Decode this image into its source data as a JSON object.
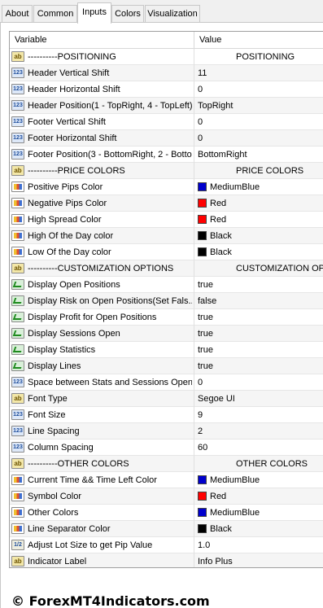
{
  "tabs": [
    {
      "label": "About",
      "active": false
    },
    {
      "label": "Common",
      "active": false
    },
    {
      "label": "Inputs",
      "active": true
    },
    {
      "label": "Colors",
      "active": false
    },
    {
      "label": "Visualization",
      "active": false
    }
  ],
  "grid": {
    "col_variable": "Variable",
    "col_value": "Value"
  },
  "rows": [
    {
      "icon": "ab",
      "name": "----------POSITIONING",
      "value": "POSITIONING",
      "section": true
    },
    {
      "icon": "num",
      "name": "Header Vertical Shift",
      "value": "11"
    },
    {
      "icon": "num",
      "name": "Header Horizontal Shift",
      "value": "0"
    },
    {
      "icon": "num",
      "name": "Header Position(1 - TopRight, 4 - TopLeft)",
      "value": "TopRight"
    },
    {
      "icon": "num",
      "name": "Footer Vertical Shift",
      "value": "0"
    },
    {
      "icon": "num",
      "name": "Footer Horizontal Shift",
      "value": "0"
    },
    {
      "icon": "num",
      "name": "Footer Position(3 - BottomRight, 2 - Botto...",
      "value": "BottomRight"
    },
    {
      "icon": "ab",
      "name": "----------PRICE COLORS",
      "value": "PRICE COLORS",
      "section": true
    },
    {
      "icon": "clr",
      "name": "Positive Pips Color",
      "value": "MediumBlue",
      "color": "#0000cd"
    },
    {
      "icon": "clr",
      "name": "Negative Pips Color",
      "value": "Red",
      "color": "#ff0000"
    },
    {
      "icon": "clr",
      "name": "High Spread Color",
      "value": "Red",
      "color": "#ff0000"
    },
    {
      "icon": "clr",
      "name": "High Of the Day color",
      "value": "Black",
      "color": "#000000"
    },
    {
      "icon": "clr",
      "name": "Low Of the Day color",
      "value": "Black",
      "color": "#000000"
    },
    {
      "icon": "ab",
      "name": "----------CUSTOMIZATION OPTIONS",
      "value": "CUSTOMIZATION OPTIONS",
      "section": true
    },
    {
      "icon": "bool",
      "name": "Display Open Positions",
      "value": "true"
    },
    {
      "icon": "bool",
      "name": "Display Risk on Open Positions(Set Fals...",
      "value": "false"
    },
    {
      "icon": "bool",
      "name": "Display Profit for Open Positions",
      "value": "true"
    },
    {
      "icon": "bool",
      "name": "Display Sessions Open",
      "value": "true"
    },
    {
      "icon": "bool",
      "name": "Display Statistics",
      "value": "true"
    },
    {
      "icon": "bool",
      "name": "Display Lines",
      "value": "true"
    },
    {
      "icon": "num",
      "name": "Space between Stats and Sessions Open",
      "value": "0"
    },
    {
      "icon": "ab",
      "name": "Font Type",
      "value": "Segoe UI"
    },
    {
      "icon": "num",
      "name": "Font Size",
      "value": "9"
    },
    {
      "icon": "num",
      "name": "Line Spacing",
      "value": "2"
    },
    {
      "icon": "num",
      "name": "Column Spacing",
      "value": "60"
    },
    {
      "icon": "ab",
      "name": "----------OTHER COLORS",
      "value": "OTHER COLORS",
      "section": true
    },
    {
      "icon": "clr",
      "name": "Current Time && Time Left Color",
      "value": "MediumBlue",
      "color": "#0000cd"
    },
    {
      "icon": "clr",
      "name": "Symbol Color",
      "value": "Red",
      "color": "#ff0000"
    },
    {
      "icon": "clr",
      "name": "Other Colors",
      "value": "MediumBlue",
      "color": "#0000cd"
    },
    {
      "icon": "clr",
      "name": "Line Separator Color",
      "value": "Black",
      "color": "#000000"
    },
    {
      "icon": "dbl",
      "name": "Adjust Lot Size to get Pip Value",
      "value": "1.0"
    },
    {
      "icon": "ab",
      "name": "Indicator Label",
      "value": "Info Plus"
    }
  ],
  "icon_labels": {
    "ab": "ab",
    "num": "123",
    "dbl": "1/2"
  },
  "watermark": "© ForexMT4Indicators.com"
}
